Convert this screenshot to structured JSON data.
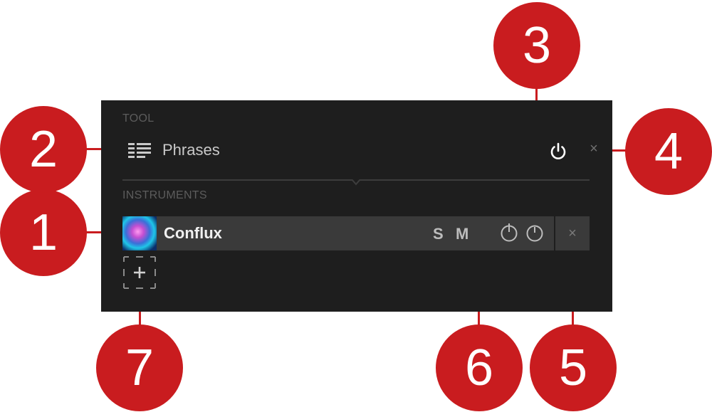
{
  "panel": {
    "tool_section_label": "TOOL",
    "tool_name": "Phrases",
    "instruments_section_label": "INSTRUMENTS",
    "instrument": {
      "name": "Conflux",
      "solo_label": "S",
      "mute_label": "M"
    },
    "close_symbol": "×"
  },
  "callouts": [
    "1",
    "2",
    "3",
    "4",
    "5",
    "6",
    "7"
  ],
  "colors": {
    "panel_bg": "#1e1e1e",
    "row_bg": "#3a3a3a",
    "callout_red": "#c91c1f",
    "label_gray": "#5c5c5c"
  },
  "icons": {
    "tool": "list-lines-icon",
    "power": "power-icon",
    "close": "close-icon",
    "add": "plus-icon",
    "knob": "knob-icon"
  }
}
